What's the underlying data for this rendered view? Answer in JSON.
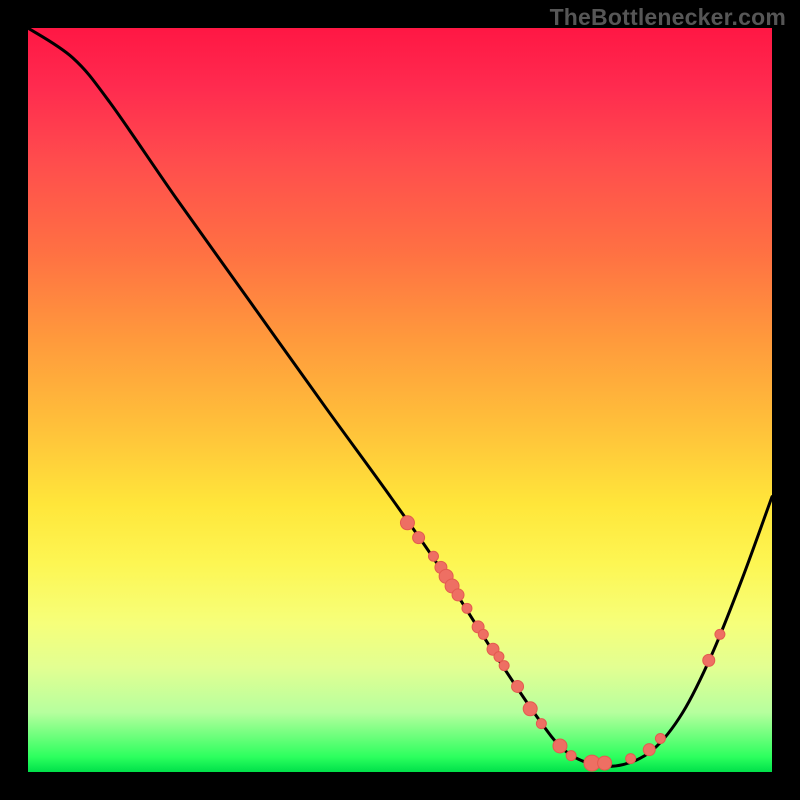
{
  "attribution": "TheBottlenecker.com",
  "colors": {
    "background": "#000000",
    "curve_stroke": "#000000",
    "marker_fill": "#ee6f63",
    "marker_stroke": "#e35b4f"
  },
  "chart_data": {
    "type": "line",
    "title": "",
    "xlabel": "",
    "ylabel": "",
    "xlim": [
      0,
      100
    ],
    "ylim": [
      0,
      100
    ],
    "curve": [
      {
        "x": 0,
        "y": 100
      },
      {
        "x": 6,
        "y": 96
      },
      {
        "x": 11,
        "y": 90
      },
      {
        "x": 20,
        "y": 77
      },
      {
        "x": 30,
        "y": 63
      },
      {
        "x": 40,
        "y": 49
      },
      {
        "x": 48,
        "y": 38
      },
      {
        "x": 55,
        "y": 28
      },
      {
        "x": 62,
        "y": 17
      },
      {
        "x": 68,
        "y": 8
      },
      {
        "x": 72,
        "y": 3
      },
      {
        "x": 76,
        "y": 1
      },
      {
        "x": 80,
        "y": 1
      },
      {
        "x": 84,
        "y": 3
      },
      {
        "x": 88,
        "y": 8
      },
      {
        "x": 92,
        "y": 16
      },
      {
        "x": 96,
        "y": 26
      },
      {
        "x": 100,
        "y": 37
      }
    ],
    "markers": [
      {
        "x": 51.0,
        "y": 33.5,
        "r": 7
      },
      {
        "x": 52.5,
        "y": 31.5,
        "r": 6
      },
      {
        "x": 54.5,
        "y": 29.0,
        "r": 5
      },
      {
        "x": 55.5,
        "y": 27.5,
        "r": 6
      },
      {
        "x": 56.2,
        "y": 26.3,
        "r": 7
      },
      {
        "x": 57.0,
        "y": 25.0,
        "r": 7
      },
      {
        "x": 57.8,
        "y": 23.8,
        "r": 6
      },
      {
        "x": 59.0,
        "y": 22.0,
        "r": 5
      },
      {
        "x": 60.5,
        "y": 19.5,
        "r": 6
      },
      {
        "x": 61.2,
        "y": 18.5,
        "r": 5
      },
      {
        "x": 62.5,
        "y": 16.5,
        "r": 6
      },
      {
        "x": 63.3,
        "y": 15.5,
        "r": 5
      },
      {
        "x": 64.0,
        "y": 14.3,
        "r": 5
      },
      {
        "x": 65.8,
        "y": 11.5,
        "r": 6
      },
      {
        "x": 67.5,
        "y": 8.5,
        "r": 7
      },
      {
        "x": 69.0,
        "y": 6.5,
        "r": 5
      },
      {
        "x": 71.5,
        "y": 3.5,
        "r": 7
      },
      {
        "x": 73.0,
        "y": 2.2,
        "r": 5
      },
      {
        "x": 75.8,
        "y": 1.2,
        "r": 8
      },
      {
        "x": 77.5,
        "y": 1.2,
        "r": 7
      },
      {
        "x": 81.0,
        "y": 1.8,
        "r": 5
      },
      {
        "x": 83.5,
        "y": 3.0,
        "r": 6
      },
      {
        "x": 85.0,
        "y": 4.5,
        "r": 5
      },
      {
        "x": 91.5,
        "y": 15.0,
        "r": 6
      },
      {
        "x": 93.0,
        "y": 18.5,
        "r": 5
      }
    ]
  }
}
